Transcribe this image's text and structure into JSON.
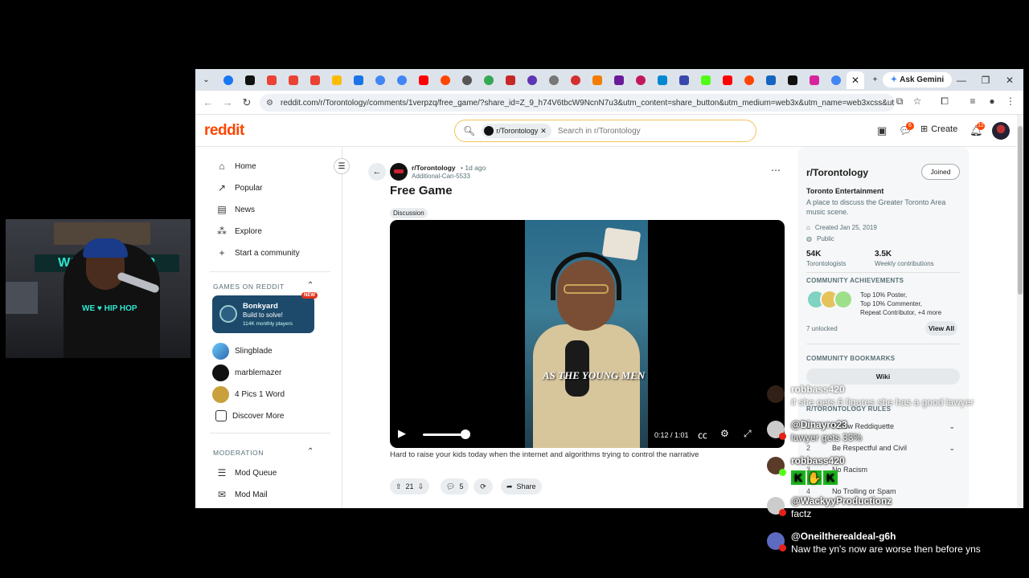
{
  "browser": {
    "gemini_label": "Ask Gemini",
    "url": "reddit.com/r/Torontology/comments/1verpzq/free_game/?share_id=Z_9_h74V6tbcW9NcnN7u3&utm_content=share_button&utm_medium=web3x&utm_name=web3xcss&utm_so..."
  },
  "header": {
    "logo": "reddit",
    "search_chip": "r/Torontology",
    "search_placeholder": "Search in r/Torontology",
    "create_label": "Create",
    "chat_badge": "6",
    "notif_badge": "12"
  },
  "sidebar": {
    "nav": [
      "Home",
      "Popular",
      "News",
      "Explore",
      "Start a community"
    ],
    "games_heading": "GAMES ON REDDIT",
    "featured_game": {
      "name": "Bonkyard",
      "tagline": "Build to solve!",
      "players": "114K monthly players",
      "badge": "NEW"
    },
    "games": [
      "Slingblade",
      "marblemazer",
      "4 Pics 1 Word",
      "Discover More"
    ],
    "moderation_heading": "MODERATION",
    "moderation": [
      "Mod Queue",
      "Mod Mail"
    ]
  },
  "post": {
    "subreddit": "r/Torontology",
    "time": "• 1d ago",
    "author": "Additional-Can-5533",
    "title": "Free Game",
    "flair": "Discussion",
    "video_caption_overlay": "AS THE YOUNG MEN",
    "video_time": "0:12 / 1:01",
    "video_progress": 0.197,
    "body": "Hard to raise your kids today when the internet and algorithms trying to control the narrative",
    "upvotes": "21",
    "comments": "5",
    "share_label": "Share"
  },
  "community": {
    "name": "r/Torontology",
    "joined_label": "Joined",
    "subtitle": "Toronto Entertainment",
    "description": "A place to discuss the Greater Toronto Area music scene.",
    "created": "Created Jan 25, 2019",
    "visibility": "Public",
    "members": "54K",
    "members_label": "Torontologists",
    "contributions": "3.5K",
    "contributions_label": "Weekly contributions",
    "achievements_heading": "COMMUNITY ACHIEVEMENTS",
    "achievements": [
      "Top 10% Poster,",
      "Top 10% Commenter,",
      "Repeat Contributor, +4 more"
    ],
    "unlocked": "7 unlocked",
    "view_all": "View All",
    "bookmarks_heading": "COMMUNITY BOOKMARKS",
    "wiki": "Wiki",
    "rules_heading": "R/TORONTOLOGY RULES",
    "rules": [
      {
        "num": "1",
        "text": "Follow Reddiquette"
      },
      {
        "num": "2",
        "text": "Be Respectful and Civil"
      },
      {
        "num": "3",
        "text": "No Racism"
      },
      {
        "num": "4",
        "text": "No Trolling or Spam"
      }
    ]
  },
  "chat": [
    {
      "name": "robbass420",
      "text": "if she gets 6 figures she has a good lawyer"
    },
    {
      "name": "@Dinayro23",
      "text": "lawyer gets 33%"
    },
    {
      "name": "robbass420",
      "text": ""
    },
    {
      "name": "@WackyyProductionz",
      "text": "factz"
    },
    {
      "name": "@Oneiltherealdeal-g6h",
      "text": "Naw the yn's now are worse then before yns"
    }
  ],
  "webcam": {
    "banner": "WE ♥ HIP HOP",
    "shirt": "WE ♥ HIP HOP"
  },
  "colors": {
    "reddit_orange": "#ff4500",
    "bonkyard_bg": "#1d4a6b",
    "search_border": "#f0c35a"
  }
}
